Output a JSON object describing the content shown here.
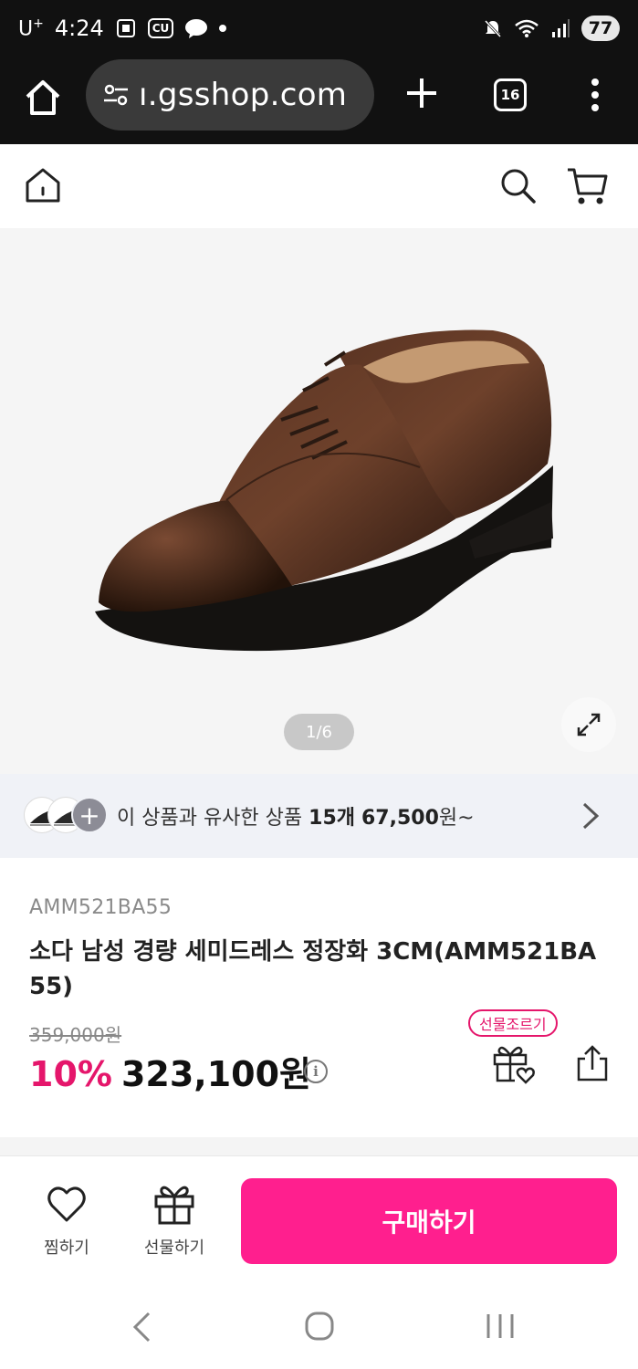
{
  "status_bar": {
    "carrier": "U",
    "carrier_sup": "+",
    "time": "4:24",
    "icons": [
      "screenshot-icon",
      "cu-icon",
      "talk-icon",
      "dot-icon"
    ],
    "cu_label": "CU",
    "talk_label": "TALK",
    "right_icons": [
      "mute-icon",
      "wifi-icon",
      "signal-icon"
    ],
    "battery": "77"
  },
  "browser": {
    "url": "ı.gsshop.com",
    "tab_count": "16",
    "icons": [
      "home-icon",
      "tune-icon",
      "plus-icon",
      "tabs-icon",
      "menu-dots-icon"
    ]
  },
  "header": {
    "icons": [
      "home-icon",
      "search-icon",
      "cart-icon"
    ]
  },
  "gallery": {
    "counter": "1/6",
    "current": 1,
    "total": 6,
    "expand_icon": "expand-icon"
  },
  "similar": {
    "prefix": "이 상품과 유사한 상품 ",
    "count": "15개",
    "price": "67,500",
    "suffix": "원~"
  },
  "product": {
    "code": "AMM521BA55",
    "title": "소다 남성 경량 세미드레스 정장화 3CM(AMM521BA55)",
    "original_price": "359,000원",
    "discount": "10%",
    "price": "323,100원",
    "info_icon": "i",
    "gift_chip": "선물조르기"
  },
  "action_bar": {
    "wishlist_label": "찜하기",
    "gift_label": "선물하기",
    "buy_label": "구매하기"
  },
  "colors": {
    "accent_pink": "#ff1f8e",
    "discount_pink": "#e5166b",
    "status_bar": "#111111"
  }
}
